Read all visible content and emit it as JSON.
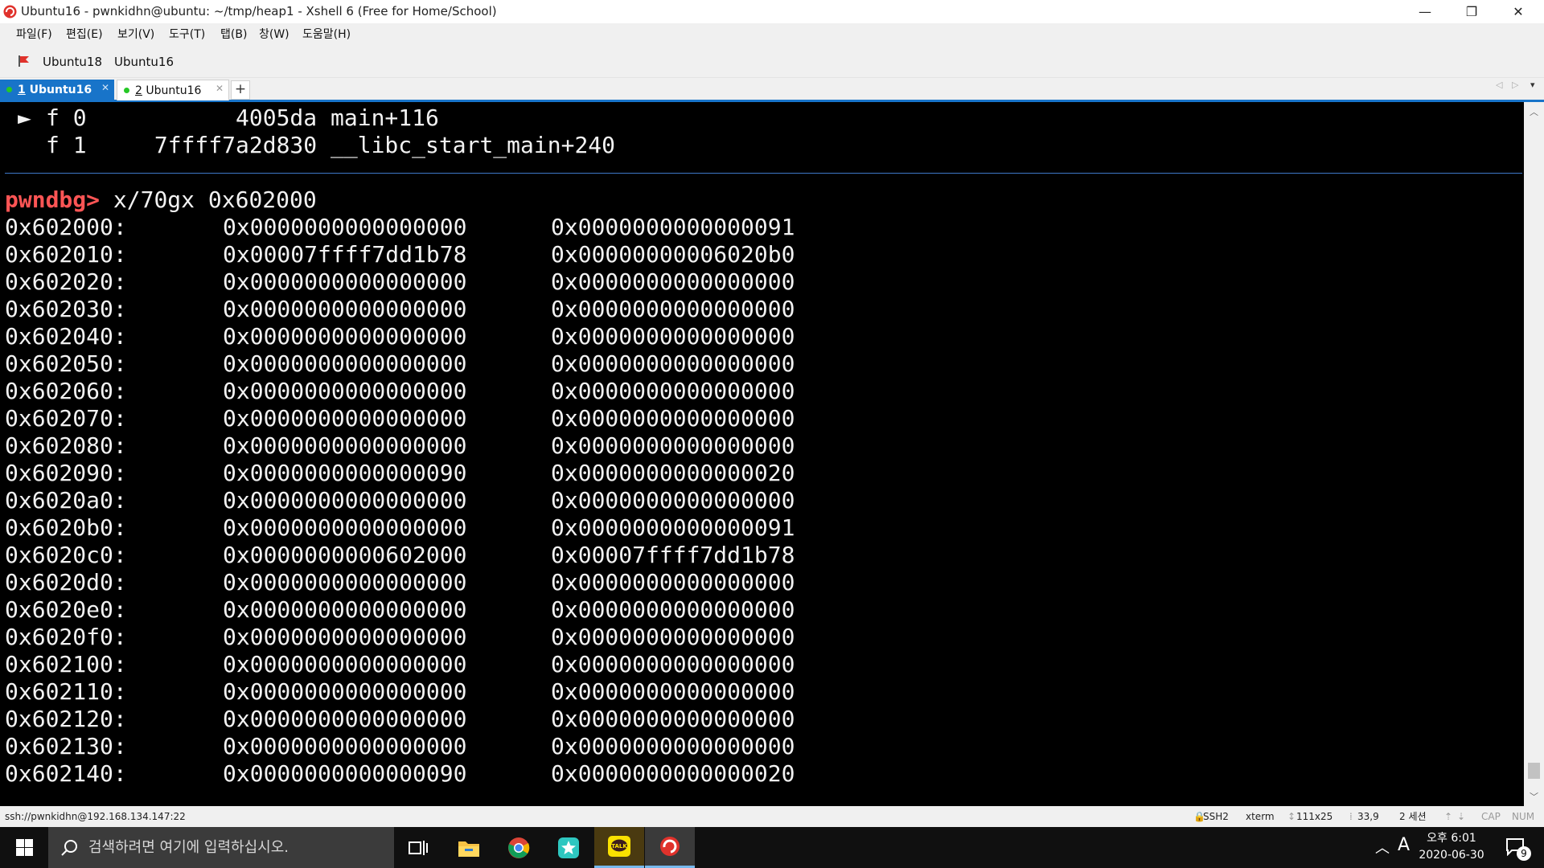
{
  "window": {
    "title": "Ubuntu16 - pwnkidhn@ubuntu: ~/tmp/heap1 - Xshell 6 (Free for Home/School)",
    "controls": {
      "minimize": "—",
      "restore": "❐",
      "close": "✕"
    }
  },
  "menu": [
    "파일(F)",
    "편집(E)",
    "보기(V)",
    "도구(T)",
    "탭(B)",
    "창(W)",
    "도움말(H)"
  ],
  "links": [
    "Ubuntu18",
    "Ubuntu16"
  ],
  "tabs": [
    {
      "num": "1",
      "label": "Ubuntu16",
      "active": true
    },
    {
      "num": "2",
      "label": "Ubuntu16",
      "active": false
    }
  ],
  "tab_add": "+",
  "terminal": {
    "frames": [
      {
        "marker": "►",
        "text": "f 0           4005da main+116"
      },
      {
        "marker": "",
        "text": "f 1     7ffff7a2d830 __libc_start_main+240"
      }
    ],
    "prompt": "pwndbg>",
    "command": "x/70gx 0x602000",
    "memory": [
      [
        "0x602000:",
        "0x0000000000000000",
        "0x0000000000000091"
      ],
      [
        "0x602010:",
        "0x00007ffff7dd1b78",
        "0x00000000006020b0"
      ],
      [
        "0x602020:",
        "0x0000000000000000",
        "0x0000000000000000"
      ],
      [
        "0x602030:",
        "0x0000000000000000",
        "0x0000000000000000"
      ],
      [
        "0x602040:",
        "0x0000000000000000",
        "0x0000000000000000"
      ],
      [
        "0x602050:",
        "0x0000000000000000",
        "0x0000000000000000"
      ],
      [
        "0x602060:",
        "0x0000000000000000",
        "0x0000000000000000"
      ],
      [
        "0x602070:",
        "0x0000000000000000",
        "0x0000000000000000"
      ],
      [
        "0x602080:",
        "0x0000000000000000",
        "0x0000000000000000"
      ],
      [
        "0x602090:",
        "0x0000000000000090",
        "0x0000000000000020"
      ],
      [
        "0x6020a0:",
        "0x0000000000000000",
        "0x0000000000000000"
      ],
      [
        "0x6020b0:",
        "0x0000000000000000",
        "0x0000000000000091"
      ],
      [
        "0x6020c0:",
        "0x0000000000602000",
        "0x00007ffff7dd1b78"
      ],
      [
        "0x6020d0:",
        "0x0000000000000000",
        "0x0000000000000000"
      ],
      [
        "0x6020e0:",
        "0x0000000000000000",
        "0x0000000000000000"
      ],
      [
        "0x6020f0:",
        "0x0000000000000000",
        "0x0000000000000000"
      ],
      [
        "0x602100:",
        "0x0000000000000000",
        "0x0000000000000000"
      ],
      [
        "0x602110:",
        "0x0000000000000000",
        "0x0000000000000000"
      ],
      [
        "0x602120:",
        "0x0000000000000000",
        "0x0000000000000000"
      ],
      [
        "0x602130:",
        "0x0000000000000000",
        "0x0000000000000000"
      ],
      [
        "0x602140:",
        "0x0000000000000090",
        "0x0000000000000020"
      ]
    ]
  },
  "status": {
    "connection": "ssh://pwnkidhn@192.168.134.147:22",
    "protocol": "SSH2",
    "term": "xterm",
    "size": "111x25",
    "cursor": "33,9",
    "sessions": "2 세션",
    "cap": "CAP",
    "num": "NUM"
  },
  "taskbar": {
    "search_placeholder": "검색하려면 여기에 입력하십시오.",
    "time": "오후 6:01",
    "date": "2020-06-30",
    "ime": "A",
    "notification_count": "9",
    "apps": [
      "task-view",
      "file-explorer",
      "chrome",
      "app-star",
      "kakaotalk",
      "xshell"
    ]
  },
  "colors": {
    "prompt": "#ff5555",
    "tab_active": "#1874c9",
    "separator": "#3e78c8"
  }
}
